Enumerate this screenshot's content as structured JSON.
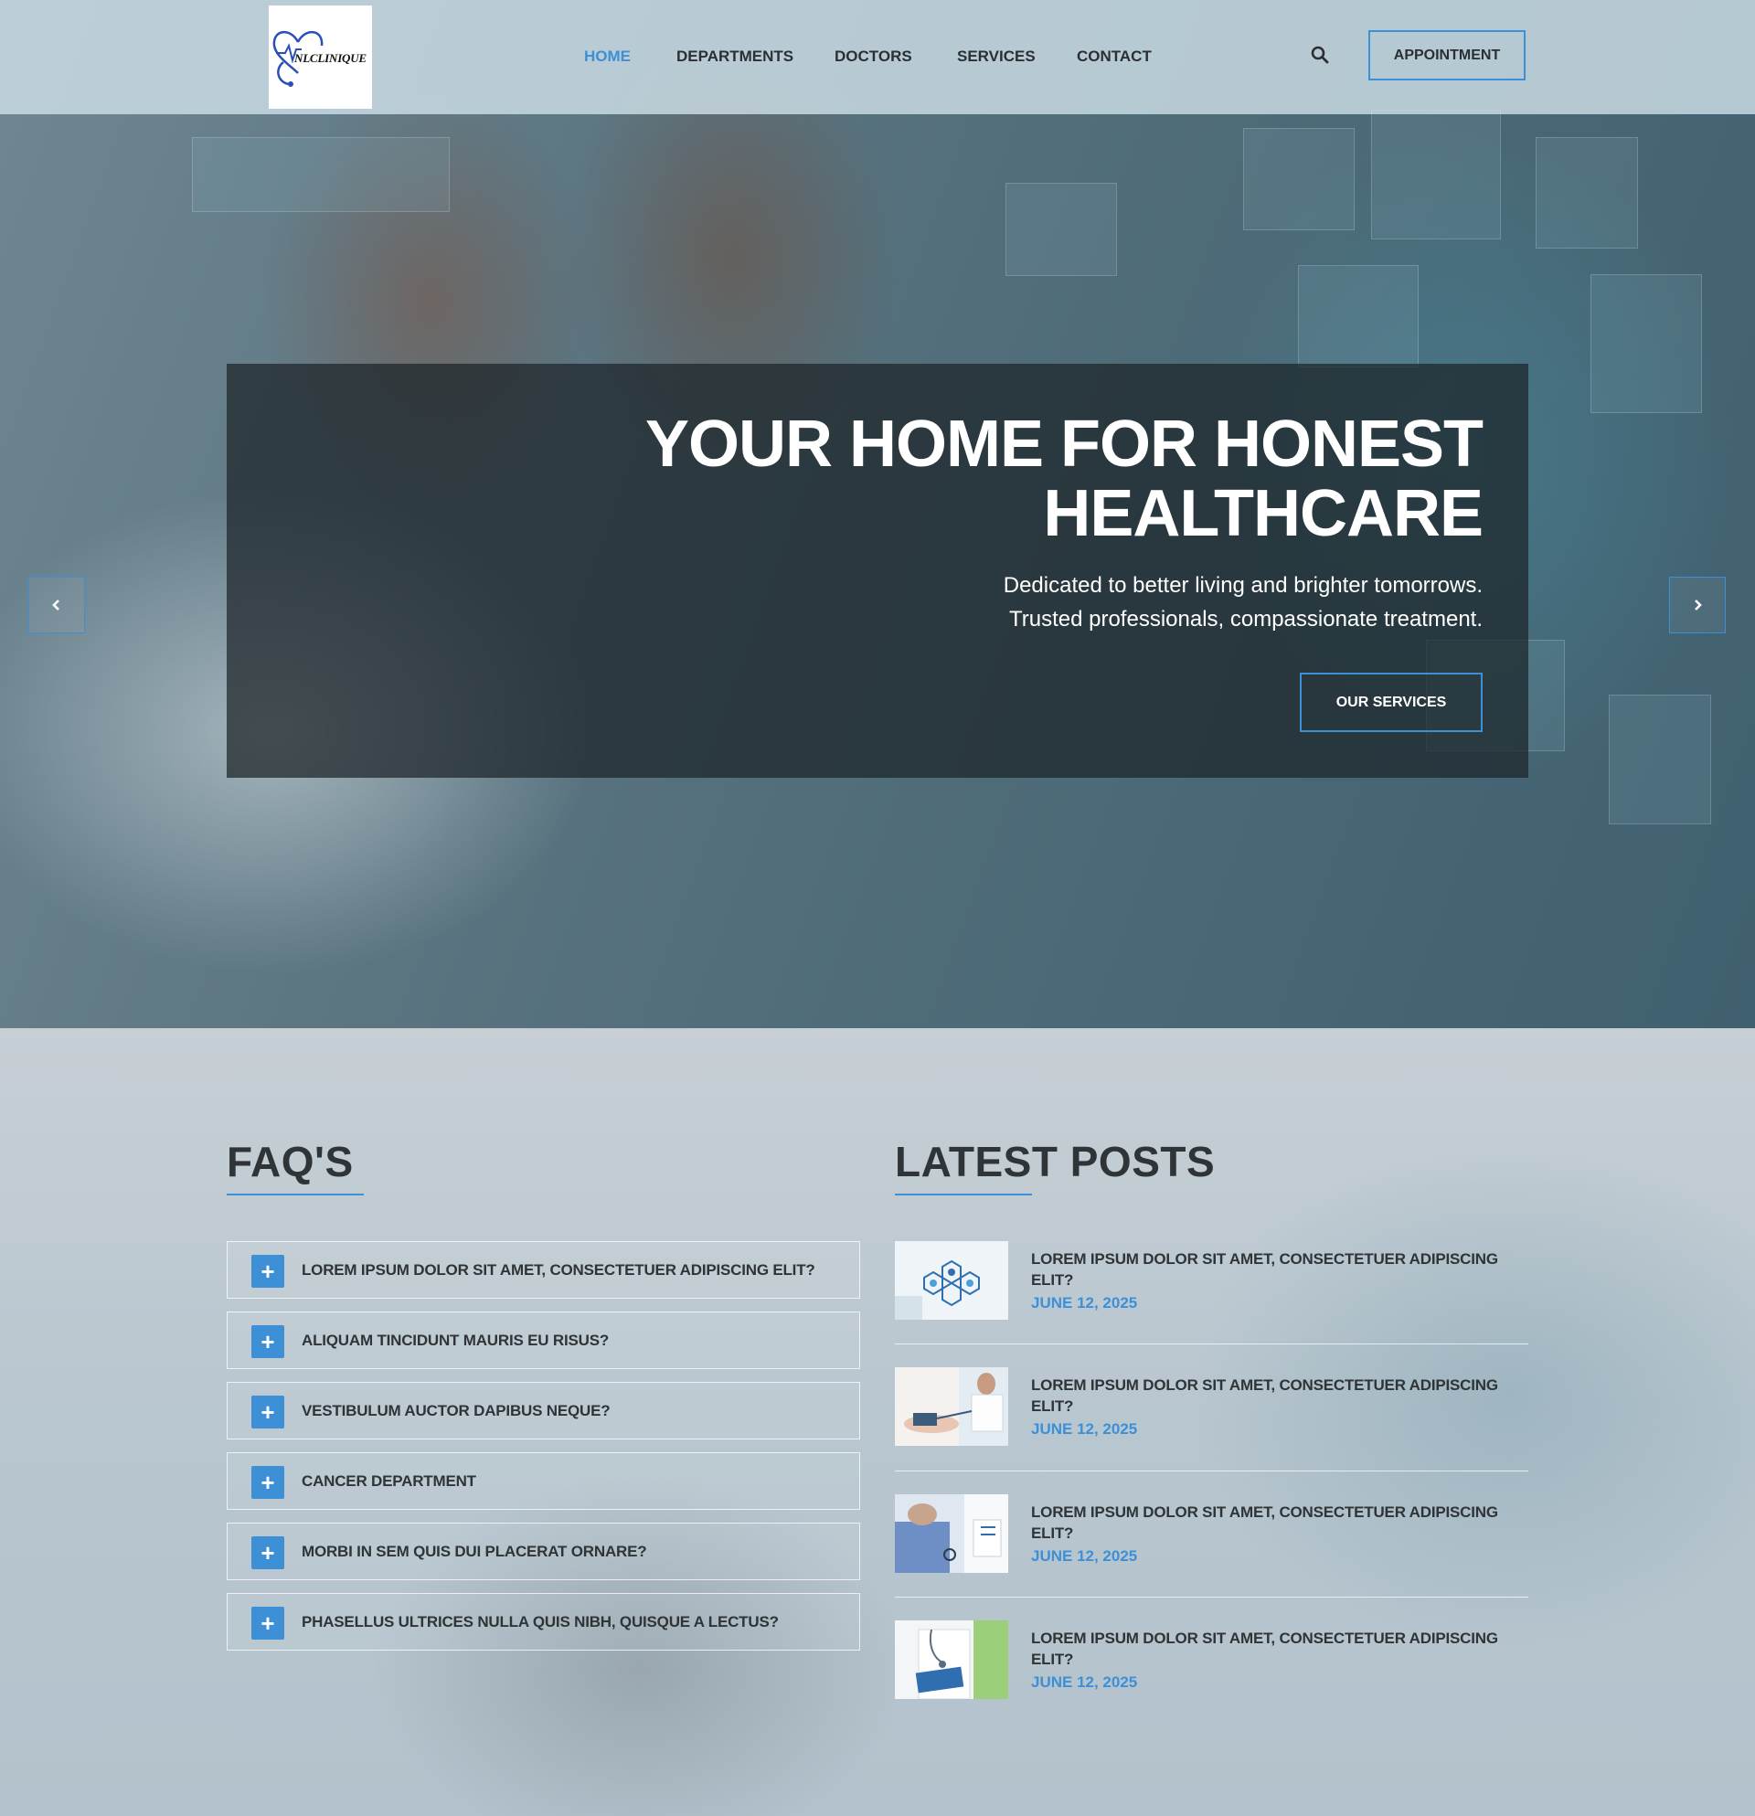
{
  "header": {
    "logo_text": "NLCLINIQUE",
    "nav": [
      "HOME",
      "DEPARTMENTS",
      "DOCTORS",
      "SERVICES",
      "CONTACT"
    ],
    "active_nav": "HOME",
    "appointment_label": "APPOINTMENT"
  },
  "hero": {
    "title_line1": "YOUR HOME FOR HONEST",
    "title_line2": "HEALTHCARE",
    "subtitle_line1": "Dedicated to better living and brighter tomorrows.",
    "subtitle_line2": "Trusted professionals, compassionate treatment.",
    "button_label": "OUR SERVICES"
  },
  "faq": {
    "title": "FAQ'S",
    "items": [
      "LOREM IPSUM DOLOR SIT AMET, CONSECTETUER ADIPISCING ELIT?",
      "ALIQUAM TINCIDUNT MAURIS EU RISUS?",
      "VESTIBULUM AUCTOR DAPIBUS NEQUE?",
      "CANCER DEPARTMENT",
      "MORBI IN SEM QUIS DUI PLACERAT ORNARE?",
      "PHASELLUS ULTRICES NULLA QUIS NIBH, QUISQUE A LECTUS?"
    ]
  },
  "posts": {
    "title": "LATEST POSTS",
    "items": [
      {
        "title": "LOREM IPSUM DOLOR SIT AMET, CONSECTETUER ADIPISCING ELIT?",
        "date": "JUNE 12, 2025"
      },
      {
        "title": "LOREM IPSUM DOLOR SIT AMET, CONSECTETUER ADIPISCING ELIT?",
        "date": "JUNE 12, 2025"
      },
      {
        "title": "LOREM IPSUM DOLOR SIT AMET, CONSECTETUER ADIPISCING ELIT?",
        "date": "JUNE 12, 2025"
      },
      {
        "title": "LOREM IPSUM DOLOR SIT AMET, CONSECTETUER ADIPISCING ELIT?",
        "date": "JUNE 12, 2025"
      }
    ]
  },
  "icons": {
    "search": "search-icon",
    "prev": "chevron-left-icon",
    "next": "chevron-right-icon",
    "faq_expand": "plus-icon"
  },
  "colors": {
    "accent": "#3d8fd6",
    "text_dark": "#2f3436",
    "hero_overlay": "#1c2428",
    "header_bg": "#cddee6"
  }
}
